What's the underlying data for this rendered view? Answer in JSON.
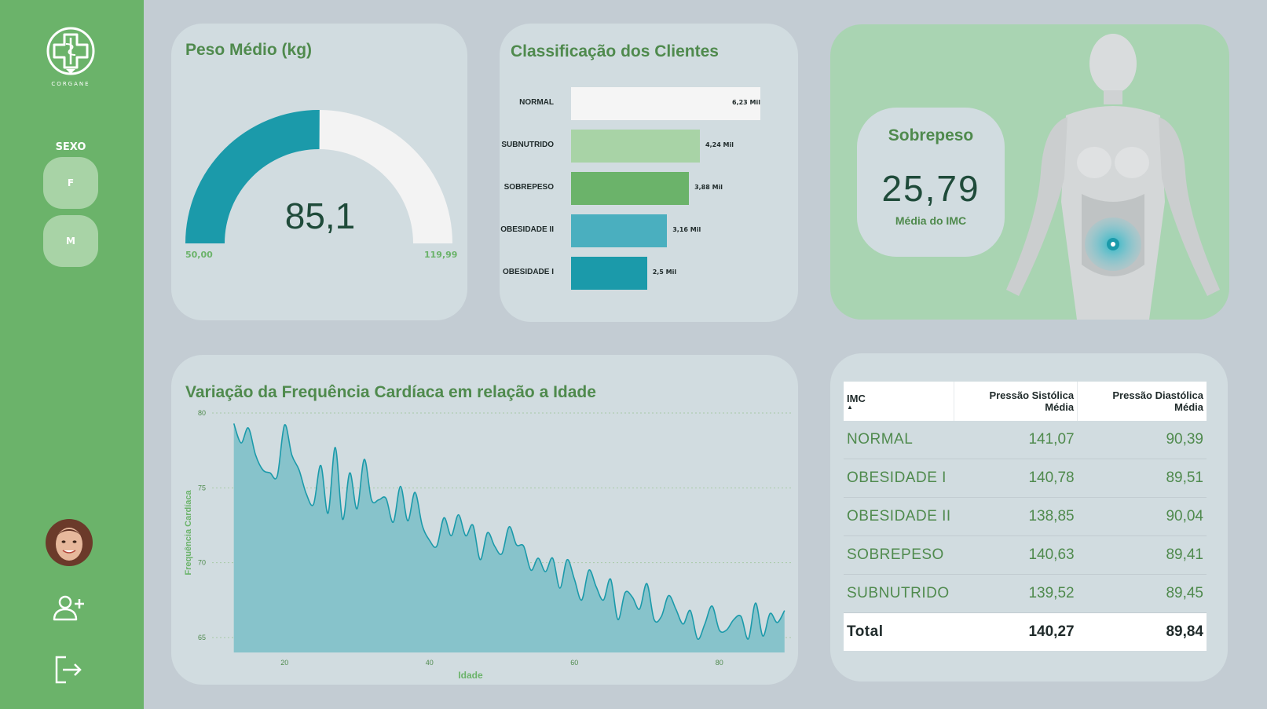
{
  "sidebar": {
    "logo_text": "CORGANE",
    "filter_label": "SEXO",
    "filter_options": [
      "F",
      "M"
    ]
  },
  "gauge_card": {
    "title": "Peso Médio (kg)",
    "value": "85,1",
    "min_label": "50,00",
    "max_label": "119,99",
    "min": 50.0,
    "max": 119.99,
    "current": 85.1,
    "colors": {
      "fill": "#1b9aaa",
      "track": "#f3f3f3"
    }
  },
  "class_card": {
    "title": "Classificação dos Clientes",
    "chart_data": {
      "type": "bar",
      "orientation": "horizontal",
      "title": "Classificação dos Clientes",
      "categories": [
        "NORMAL",
        "SUBNUTRIDO",
        "SOBREPESO",
        "OBESIDADE II",
        "OBESIDADE I"
      ],
      "values": [
        6230,
        4240,
        3880,
        3160,
        2500
      ],
      "data_labels": [
        "6,23 Mil",
        "4,24 Mil",
        "3,88 Mil",
        "3,16 Mil",
        "2,5 Mil"
      ],
      "colors": [
        "#f5f5f5",
        "#a8d3a6",
        "#6bb36a",
        "#4aafbf",
        "#1b9aaa"
      ]
    }
  },
  "imc_card": {
    "title": "Sobrepeso",
    "value": "25,79",
    "subtitle": "Média do IMC"
  },
  "hr_card": {
    "title": "Variação da Frequência Cardíaca em relação a Idade",
    "chart_data": {
      "type": "area",
      "title": "Variação da Frequência Cardíaca em relação a Idade",
      "xlabel": "Idade",
      "ylabel": "Frequência Cardíaca",
      "xlim": [
        10,
        90
      ],
      "ylim": [
        64,
        80
      ],
      "x_ticks": [
        20,
        40,
        60,
        80
      ],
      "y_ticks": [
        65,
        70,
        75,
        80
      ],
      "grid": true,
      "color": "#1b9aaa",
      "fill": "#87c3cb",
      "x": [
        13,
        14,
        15,
        16,
        17,
        18,
        19,
        20,
        21,
        22,
        23,
        24,
        25,
        26,
        27,
        28,
        29,
        30,
        31,
        32,
        33,
        34,
        35,
        36,
        37,
        38,
        39,
        40,
        41,
        42,
        43,
        44,
        45,
        46,
        47,
        48,
        49,
        50,
        51,
        52,
        53,
        54,
        55,
        56,
        57,
        58,
        59,
        60,
        61,
        62,
        63,
        64,
        65,
        66,
        67,
        68,
        69,
        70,
        71,
        72,
        73,
        74,
        75,
        76,
        77,
        78,
        79,
        80,
        81,
        82,
        83,
        84,
        85,
        86,
        87,
        88,
        89
      ],
      "y": [
        79.3,
        78.0,
        79.0,
        77.2,
        76.2,
        76.0,
        75.8,
        79.2,
        77.2,
        76.2,
        74.6,
        73.9,
        76.5,
        73.3,
        77.7,
        72.9,
        76.0,
        73.6,
        76.9,
        74.2,
        74.2,
        74.3,
        72.7,
        75.1,
        72.8,
        74.7,
        72.5,
        71.5,
        71.1,
        73.0,
        71.8,
        73.2,
        71.8,
        72.5,
        70.2,
        72.0,
        71.1,
        70.6,
        72.4,
        71.2,
        71.1,
        69.5,
        70.3,
        69.4,
        70.3,
        68.3,
        70.2,
        68.9,
        67.5,
        69.5,
        68.4,
        67.5,
        68.9,
        66.2,
        68.0,
        67.7,
        66.9,
        68.6,
        66.2,
        66.4,
        67.8,
        66.9,
        65.9,
        66.8,
        64.9,
        65.9,
        67.1,
        65.5,
        65.5,
        66.2,
        66.4,
        64.9,
        67.3,
        65.1,
        66.6,
        66.0,
        66.8
      ]
    }
  },
  "bp_table": {
    "columns": [
      "IMC",
      "Pressão Sistólica Média",
      "Pressão Diastólica Média"
    ],
    "rows": [
      [
        "NORMAL",
        "141,07",
        "90,39"
      ],
      [
        "OBESIDADE I",
        "140,78",
        "89,51"
      ],
      [
        "OBESIDADE II",
        "138,85",
        "90,04"
      ],
      [
        "SOBREPESO",
        "140,63",
        "89,41"
      ],
      [
        "SUBNUTRIDO",
        "139,52",
        "89,45"
      ]
    ],
    "total": [
      "Total",
      "140,27",
      "89,84"
    ]
  },
  "icons": {
    "logo": "medical-cross-caduceus-icon",
    "add_user": "add-user-icon",
    "logout": "logout-icon",
    "sort": "sort-ascending-icon"
  }
}
